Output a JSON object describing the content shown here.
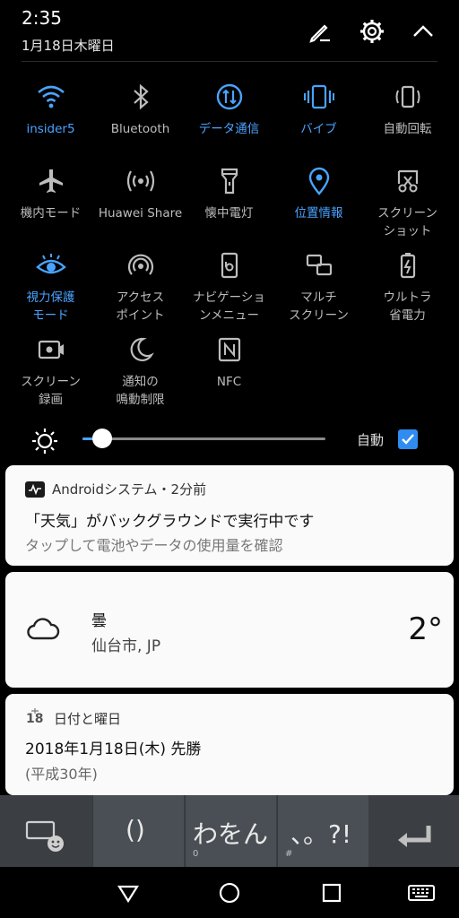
{
  "status": {
    "time": "2:35",
    "date": "1月18日木曜日"
  },
  "header_icons": [
    "edit-icon",
    "gear-icon",
    "chevron-up-icon"
  ],
  "tiles": [
    {
      "label": "insider5",
      "icon": "wifi-icon",
      "active": true
    },
    {
      "label": "Bluetooth",
      "icon": "bluetooth-icon",
      "active": false
    },
    {
      "label": "データ通信",
      "icon": "mobile-data-icon",
      "active": true
    },
    {
      "label": "バイブ",
      "icon": "vibrate-icon",
      "active": true
    },
    {
      "label": "自動回転",
      "icon": "auto-rotate-icon",
      "active": false
    },
    {
      "label": "機内モード",
      "icon": "airplane-icon",
      "active": false
    },
    {
      "label": "Huawei Share",
      "icon": "huawei-share-icon",
      "active": false
    },
    {
      "label": "懐中電灯",
      "icon": "flashlight-icon",
      "active": false
    },
    {
      "label": "位置情報",
      "icon": "location-icon",
      "active": true
    },
    {
      "label": "スクリーン\nショット",
      "icon": "screenshot-icon",
      "active": false
    },
    {
      "label": "視力保護\nモード",
      "icon": "eye-comfort-icon",
      "active": true
    },
    {
      "label": "アクセス\nポイント",
      "icon": "hotspot-icon",
      "active": false
    },
    {
      "label": "ナビゲーショ\nンメニュー",
      "icon": "navigation-dock-icon",
      "active": false
    },
    {
      "label": "マルチ\nスクリーン",
      "icon": "multi-screen-icon",
      "active": false
    },
    {
      "label": "ウルトラ\n省電力",
      "icon": "ultra-battery-icon",
      "active": false
    },
    {
      "label": "スクリーン\n録画",
      "icon": "screen-record-icon",
      "active": false
    },
    {
      "label": "通知の\n鳴動制限",
      "icon": "do-not-disturb-icon",
      "active": false
    },
    {
      "label": "NFC",
      "icon": "nfc-icon",
      "active": false
    }
  ],
  "brightness": {
    "level": 0.08,
    "auto_label": "自動",
    "auto_checked": true
  },
  "notifications": {
    "android": {
      "app": "Androidシステム・2分前",
      "title": "「天気」がバックグラウンドで実行中です",
      "text": "タップして電池やデータの使用量を確認"
    },
    "weather": {
      "condition": "曇",
      "location": "仙台市, JP",
      "temperature": "2°"
    },
    "calendar": {
      "icon_day": "18",
      "app": "日付と曜日",
      "title": "2018年1月18日(木) 先勝",
      "text": "(平成30年)"
    }
  },
  "keyboard": {
    "keys": [
      {
        "main": "()",
        "sub": ""
      },
      {
        "main": "わをん",
        "sub": "0"
      },
      {
        "main": "、。?!",
        "sub": "#"
      }
    ]
  },
  "colors": {
    "accent": "#4aa3ff",
    "tile_inactive": "#bdbdbd",
    "card_bg": "#fafafa"
  }
}
